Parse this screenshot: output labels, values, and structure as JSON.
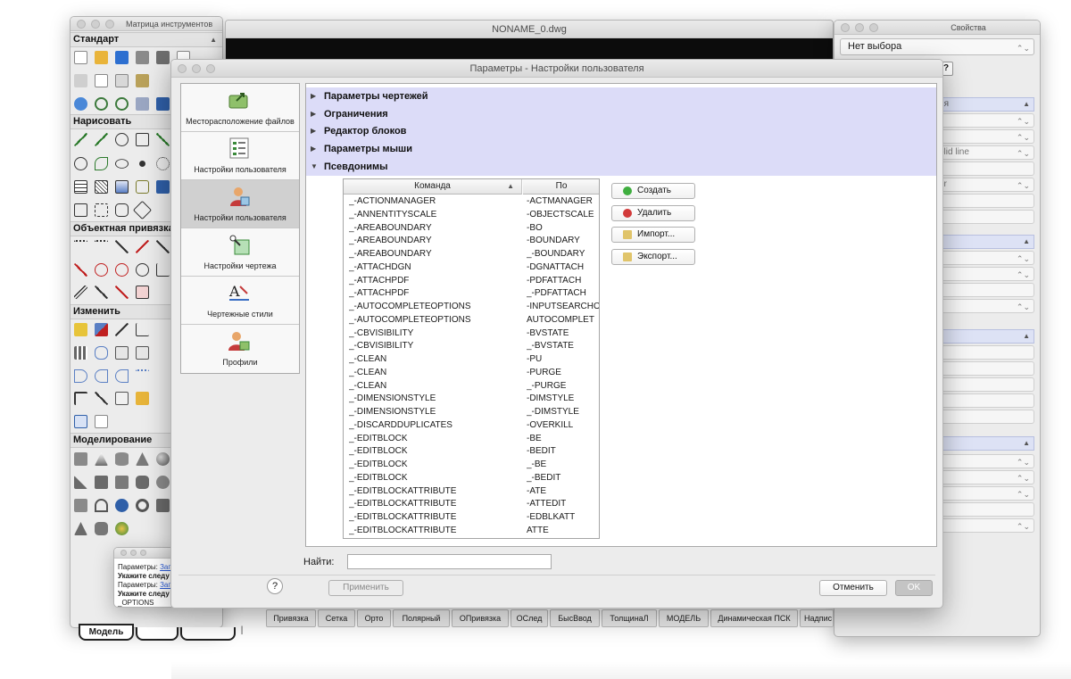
{
  "toolbar_matrix": {
    "title": "Матрица инструментов",
    "sections": {
      "standard": "Стандарт",
      "draw": "Нарисовать",
      "osnap": "Объектная привязка",
      "modify": "Изменить",
      "modeling": "Моделирование"
    }
  },
  "drawing": {
    "title": "NONAME_0.dwg"
  },
  "properties": {
    "title": "Свойства",
    "selection": "Нет выбора",
    "header_partial": "ия",
    "linetype_partial": "olid line",
    "layer_partial": "er"
  },
  "command_window": {
    "lines": [
      "Параметры: ",
      "Укажите следу",
      "Параметры: ",
      "Укажите следу",
      "_OPTIONS"
    ],
    "link": "Зап"
  },
  "dialog": {
    "title": "Параметры - Настройки пользователя",
    "nav": [
      {
        "label": "Месторасположение файлов"
      },
      {
        "label": "Настройки пользователя"
      },
      {
        "label": "Настройки пользователя"
      },
      {
        "label": "Настройки чертежа"
      },
      {
        "label": "Чертежные стили"
      },
      {
        "label": "Профили"
      }
    ],
    "categories": [
      "Параметры чертежей",
      "Ограничения",
      "Редактор блоков",
      "Параметры мыши",
      "Псевдонимы"
    ],
    "table": {
      "col_command": "Команда",
      "col_alias": "По",
      "rows": [
        [
          "_-ACTIONMANAGER",
          "-ACTMANAGER"
        ],
        [
          "_-ANNENTITYSCALE",
          "-OBJECTSCALE"
        ],
        [
          "_-AREABOUNDARY",
          "-BO"
        ],
        [
          "_-AREABOUNDARY",
          "-BOUNDARY"
        ],
        [
          "_-AREABOUNDARY",
          "_-BOUNDARY"
        ],
        [
          "_-ATTACHDGN",
          "-DGNATTACH"
        ],
        [
          "_-ATTACHPDF",
          "-PDFATTACH"
        ],
        [
          "_-ATTACHPDF",
          "_-PDFATTACH"
        ],
        [
          "_-AUTOCOMPLETEOPTIONS",
          "-INPUTSEARCHO"
        ],
        [
          "_-AUTOCOMPLETEOPTIONS",
          "AUTOCOMPLET"
        ],
        [
          "_-CBVISIBILITY",
          "-BVSTATE"
        ],
        [
          "_-CBVISIBILITY",
          "_-BVSTATE"
        ],
        [
          "_-CLEAN",
          "-PU"
        ],
        [
          "_-CLEAN",
          "-PURGE"
        ],
        [
          "_-CLEAN",
          "_-PURGE"
        ],
        [
          "_-DIMENSIONSTYLE",
          "-DIMSTYLE"
        ],
        [
          "_-DIMENSIONSTYLE",
          "_-DIMSTYLE"
        ],
        [
          "_-DISCARDDUPLICATES",
          "-OVERKILL"
        ],
        [
          "_-EDITBLOCK",
          "-BE"
        ],
        [
          "_-EDITBLOCK",
          "-BEDIT"
        ],
        [
          "_-EDITBLOCK",
          "_-BE"
        ],
        [
          "_-EDITBLOCK",
          "_-BEDIT"
        ],
        [
          "_-EDITBLOCKATTRIBUTE",
          "-ATE"
        ],
        [
          "_-EDITBLOCKATTRIBUTE",
          "-ATTEDIT"
        ],
        [
          "_-EDITBLOCKATTRIBUTE",
          "-EDBLKATT"
        ],
        [
          "_-EDITBLOCKATTRIBUTE",
          "ATTE"
        ]
      ]
    },
    "buttons": {
      "create": "Создать",
      "delete": "Удалить",
      "import": "Импорт...",
      "export": "Экспорт...",
      "help": "?",
      "apply": "Применить",
      "cancel": "Отменить",
      "ok": "OK"
    },
    "search_label": "Найти:",
    "search_value": ""
  },
  "statusbar": {
    "items": [
      "Привязка",
      "Сетка",
      "Орто",
      "Полярный",
      "ОПривязка",
      "ОСлед",
      "БысВвод",
      "ТолщинаЛ",
      "МОДЕЛЬ",
      "Динамическая ПСК",
      "Надпис"
    ]
  },
  "layout_tabs": {
    "model": "Модель"
  }
}
